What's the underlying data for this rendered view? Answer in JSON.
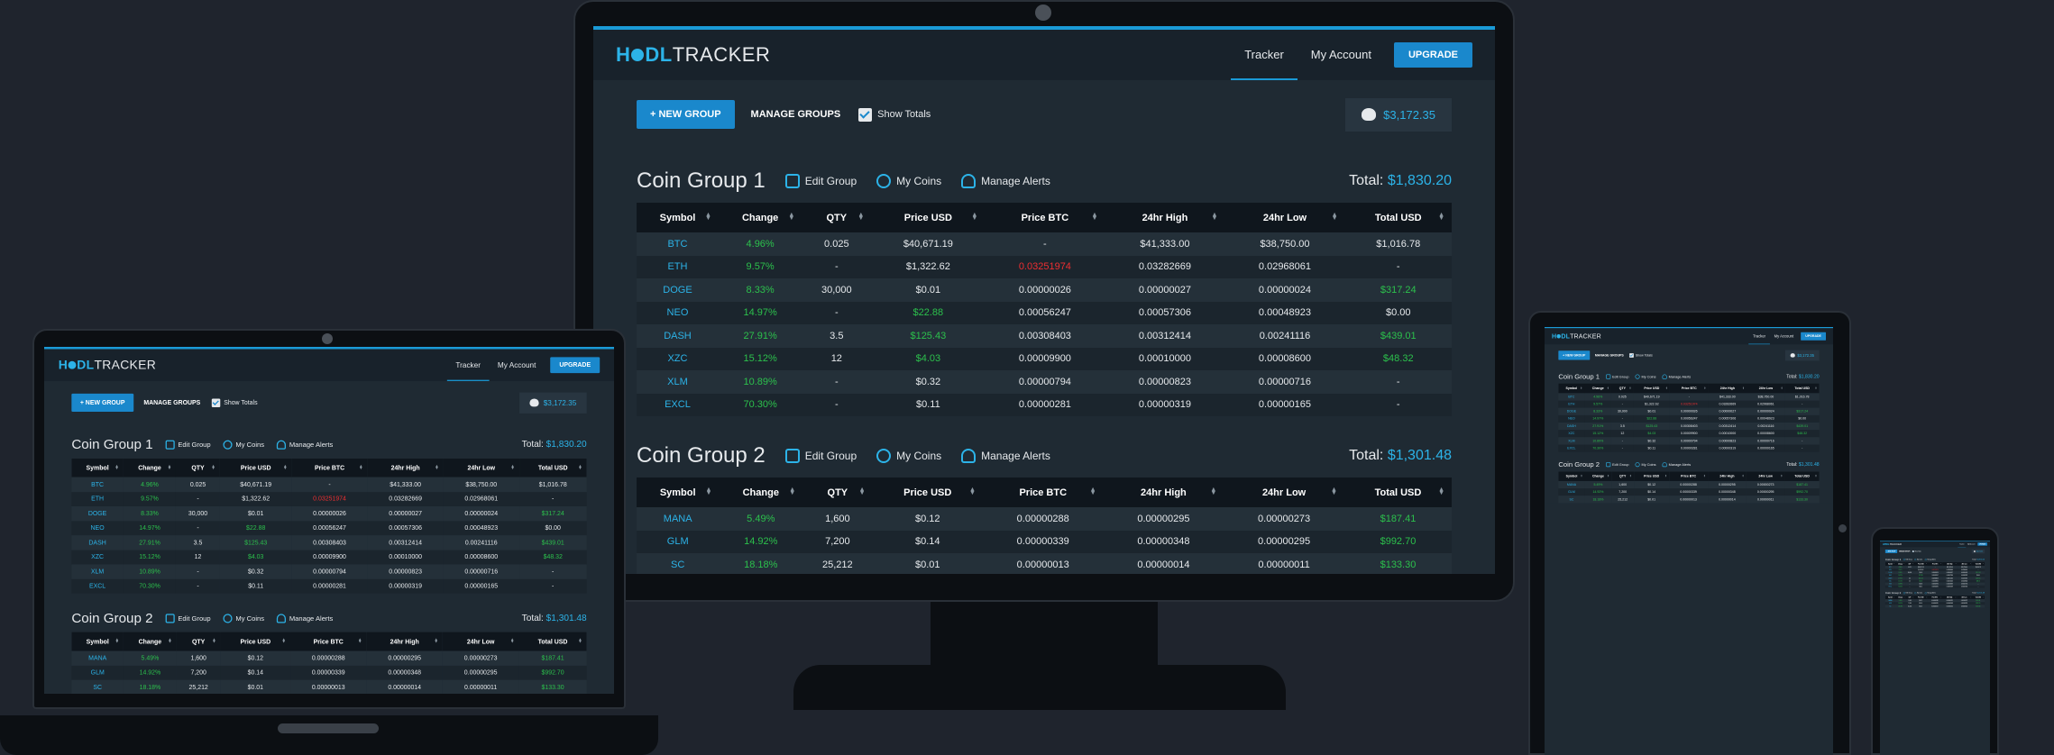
{
  "nav": {
    "logo_a": "H",
    "logo_b": "DL",
    "logo_c": "TRACKER",
    "tracker": "Tracker",
    "account": "My Account",
    "upgrade": "UPGRADE"
  },
  "toolbar": {
    "new_group": "+ NEW GROUP",
    "manage_groups": "MANAGE GROUPS",
    "show_totals": "Show Totals",
    "portfolio_total": "$3,172.35"
  },
  "actions": {
    "edit": "Edit Group",
    "coins": "My Coins",
    "alerts": "Manage Alerts",
    "total_label": "Total:"
  },
  "columns": [
    "Symbol",
    "Change",
    "QTY",
    "Price USD",
    "Price BTC",
    "24hr High",
    "24hr Low",
    "Total USD"
  ],
  "groups": [
    {
      "title": "Coin Group 1",
      "total": "$1,830.20",
      "rows": [
        [
          "BTC",
          "4.96%",
          "0.025",
          "$40,671.19",
          "-",
          "$41,333.00",
          "$38,750.00",
          "$1,016.78"
        ],
        [
          "ETH",
          "9.57%",
          "-",
          "$1,322.62",
          "0.03251974",
          "0.03282669",
          "0.02968061",
          "-"
        ],
        [
          "DOGE",
          "8.33%",
          "30,000",
          "$0.01",
          "0.00000026",
          "0.00000027",
          "0.00000024",
          "$317.24"
        ],
        [
          "NEO",
          "14.97%",
          "-",
          "$22.88",
          "0.00056247",
          "0.00057306",
          "0.00048923",
          "$0.00"
        ],
        [
          "DASH",
          "27.91%",
          "3.5",
          "$125.43",
          "0.00308403",
          "0.00312414",
          "0.00241116",
          "$439.01"
        ],
        [
          "XZC",
          "15.12%",
          "12",
          "$4.03",
          "0.00009900",
          "0.00010000",
          "0.00008600",
          "$48.32"
        ],
        [
          "XLM",
          "10.89%",
          "-",
          "$0.32",
          "0.00000794",
          "0.00000823",
          "0.00000716",
          "-"
        ],
        [
          "EXCL",
          "70.30%",
          "-",
          "$0.11",
          "0.00000281",
          "0.00000319",
          "0.00000165",
          "-"
        ]
      ],
      "styles": [
        [
          "sym",
          "g",
          "",
          "",
          "",
          "",
          "",
          ""
        ],
        [
          "sym",
          "g",
          "",
          "",
          "r",
          "",
          "",
          ""
        ],
        [
          "sym",
          "g",
          "",
          "",
          "",
          "",
          "",
          "g"
        ],
        [
          "sym",
          "g",
          "",
          "g",
          "",
          "",
          "",
          ""
        ],
        [
          "sym",
          "g",
          "",
          "g",
          "",
          "",
          "",
          "g"
        ],
        [
          "sym",
          "g",
          "",
          "g",
          "",
          "",
          "",
          "g"
        ],
        [
          "sym",
          "g",
          "",
          "",
          "",
          "",
          "",
          ""
        ],
        [
          "sym",
          "g",
          "",
          "",
          "",
          "",
          "",
          ""
        ]
      ]
    },
    {
      "title": "Coin Group 2",
      "total": "$1,301.48",
      "rows": [
        [
          "MANA",
          "5.49%",
          "1,600",
          "$0.12",
          "0.00000288",
          "0.00000295",
          "0.00000273",
          "$187.41"
        ],
        [
          "GLM",
          "14.92%",
          "7,200",
          "$0.14",
          "0.00000339",
          "0.00000348",
          "0.00000295",
          "$992.70"
        ],
        [
          "SC",
          "18.18%",
          "25,212",
          "$0.01",
          "0.00000013",
          "0.00000014",
          "0.00000011",
          "$133.30"
        ]
      ],
      "styles": [
        [
          "sym",
          "g",
          "",
          "",
          "",
          "",
          "",
          "g"
        ],
        [
          "sym",
          "g",
          "",
          "",
          "",
          "",
          "",
          "g"
        ],
        [
          "sym",
          "g",
          "",
          "",
          "",
          "",
          "",
          "g"
        ]
      ]
    }
  ]
}
